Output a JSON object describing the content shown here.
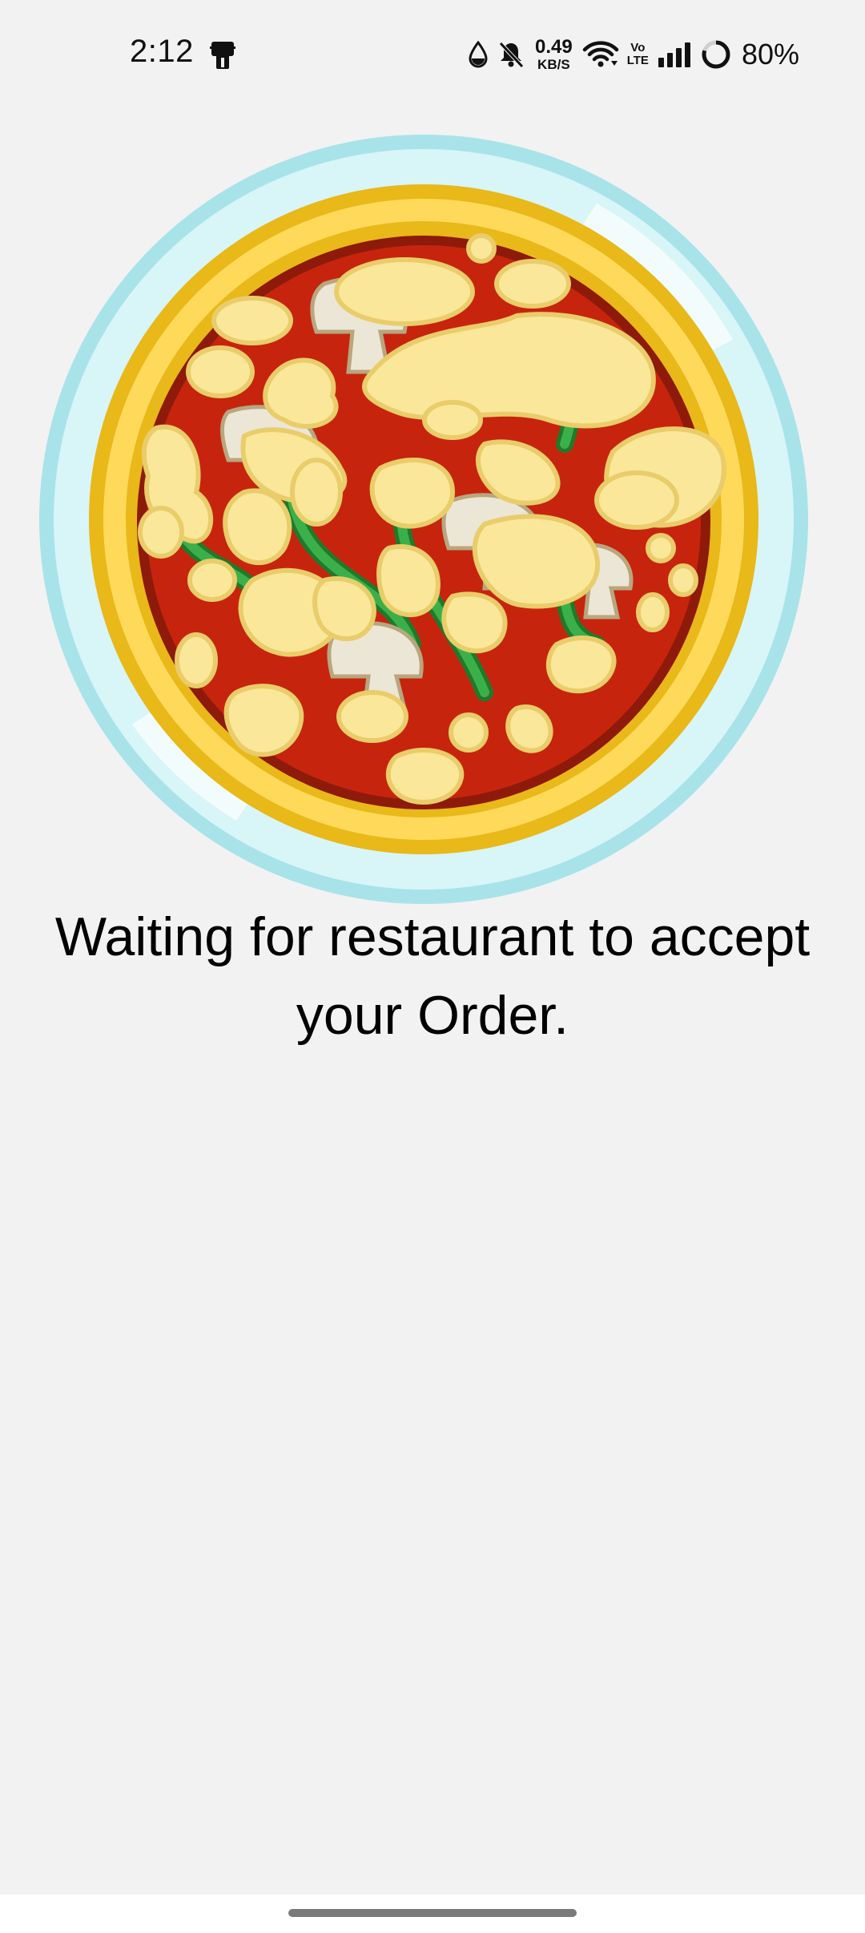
{
  "status_bar": {
    "time": "2:12",
    "net_speed_value": "0.49",
    "net_speed_unit": "KB/S",
    "volte_top": "Vo",
    "volte_bottom": "LTE",
    "battery_percent": "80%",
    "icons": [
      "notification-app-icon",
      "drop-icon",
      "mute-icon",
      "wifi-icon",
      "volte-icon",
      "signal-icon",
      "battery-ring-icon"
    ],
    "battery_level": 0.8
  },
  "illustration": {
    "name": "pizza-icon",
    "colors": {
      "plate": "#a8e3ea",
      "plate_inner": "#d8f5f8",
      "crust": "#f5c42c",
      "crust_light": "#ffd95a",
      "sauce": "#c7240e",
      "sauce_edge": "#8e1a0a",
      "pepper": "#2e9e3a",
      "cheese": "#fbe79a",
      "cheese_edge": "#e9cd6a",
      "mushroom": "#ece6d6"
    }
  },
  "message": {
    "text": "Waiting for restaurant to accept your Order."
  },
  "colors": {
    "background": "#f2f2f2",
    "nav_bar": "#ffffff",
    "gesture_pill": "#7a7a7a"
  }
}
